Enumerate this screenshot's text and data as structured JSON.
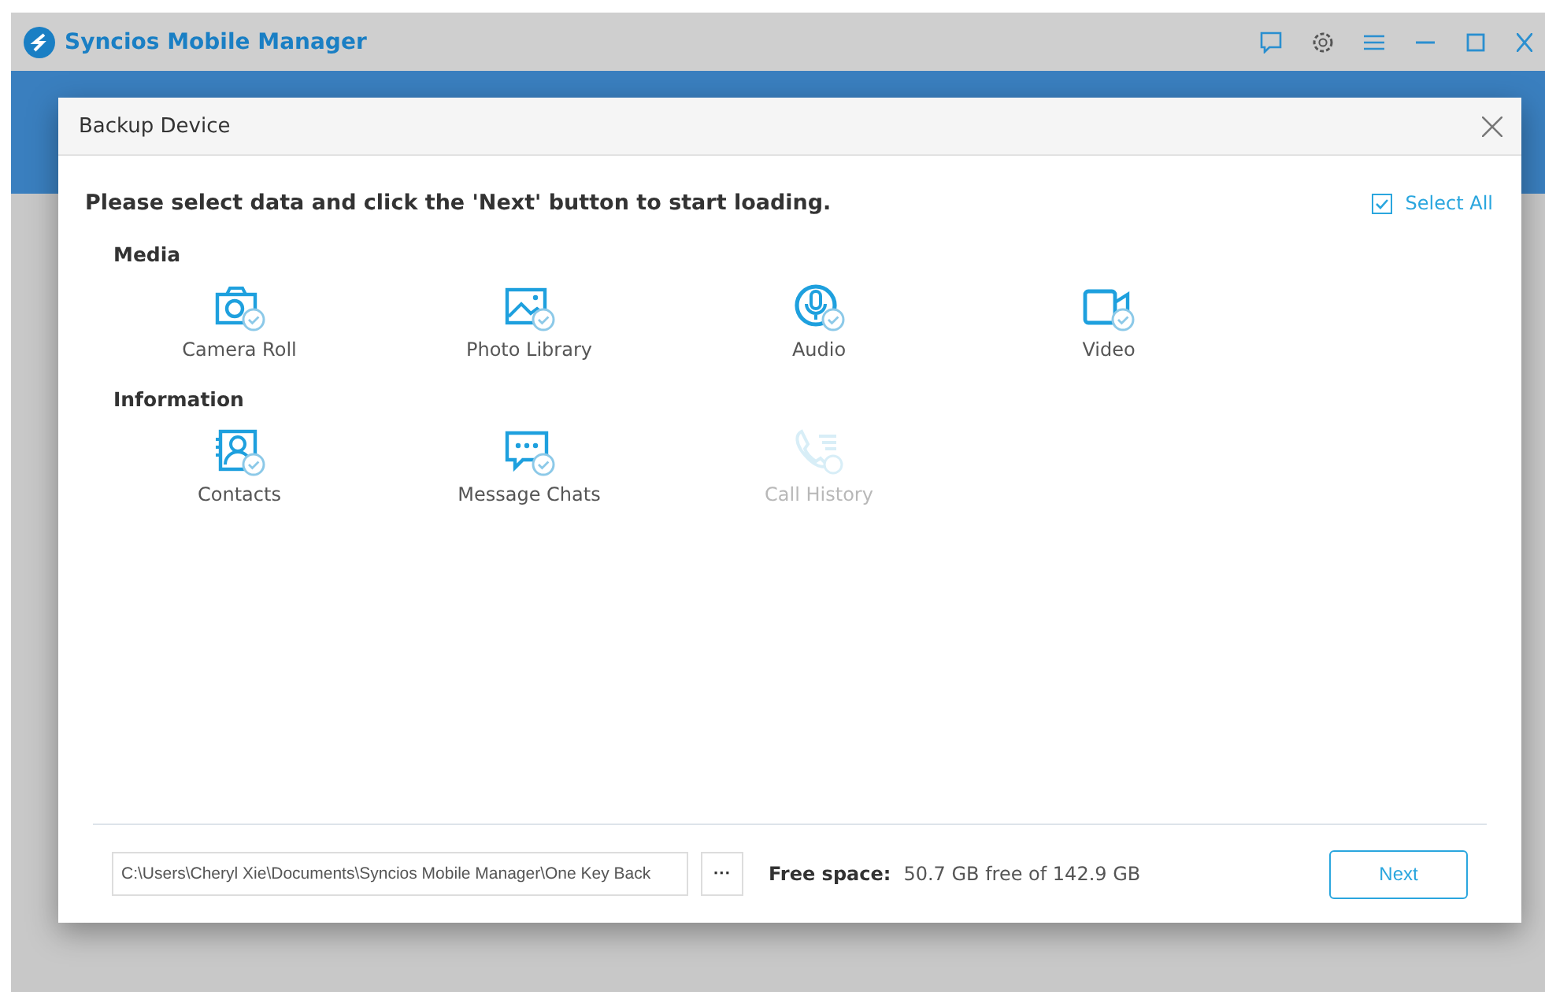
{
  "window": {
    "title": "Syncios Mobile Manager"
  },
  "dialog": {
    "title": "Backup Device",
    "instruction": "Please select data and click the 'Next' button to start loading.",
    "select_all": {
      "label": "Select All",
      "checked": true
    },
    "sections": [
      {
        "title": "Media",
        "items": [
          {
            "label": "Camera Roll",
            "checked": true,
            "disabled": false
          },
          {
            "label": "Photo Library",
            "checked": true,
            "disabled": false
          },
          {
            "label": "Audio",
            "checked": true,
            "disabled": false
          },
          {
            "label": "Video",
            "checked": true,
            "disabled": false
          }
        ]
      },
      {
        "title": "Information",
        "items": [
          {
            "label": "Contacts",
            "checked": true,
            "disabled": false
          },
          {
            "label": "Message Chats",
            "checked": true,
            "disabled": false
          },
          {
            "label": "Call History",
            "checked": false,
            "disabled": true
          }
        ]
      }
    ],
    "footer": {
      "path": "C:\\Users\\Cheryl Xie\\Documents\\Syncios Mobile Manager\\One Key Back",
      "browse": "···",
      "free_label": "Free space:",
      "free_value": "50.7 GB free of 142.9 GB",
      "next": "Next"
    }
  }
}
